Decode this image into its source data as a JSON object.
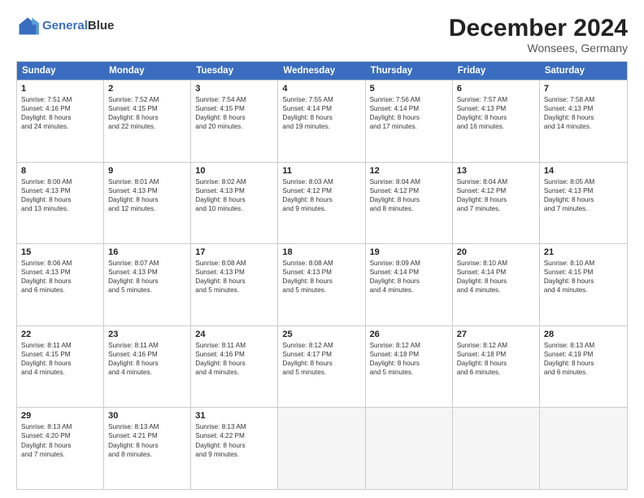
{
  "header": {
    "logo_line1": "General",
    "logo_line2": "Blue",
    "title": "December 2024",
    "subtitle": "Wonsees, Germany"
  },
  "calendar": {
    "weekdays": [
      "Sunday",
      "Monday",
      "Tuesday",
      "Wednesday",
      "Thursday",
      "Friday",
      "Saturday"
    ],
    "rows": [
      [
        {
          "day": "1",
          "lines": [
            "Sunrise: 7:51 AM",
            "Sunset: 4:16 PM",
            "Daylight: 8 hours",
            "and 24 minutes."
          ]
        },
        {
          "day": "2",
          "lines": [
            "Sunrise: 7:52 AM",
            "Sunset: 4:15 PM",
            "Daylight: 8 hours",
            "and 22 minutes."
          ]
        },
        {
          "day": "3",
          "lines": [
            "Sunrise: 7:54 AM",
            "Sunset: 4:15 PM",
            "Daylight: 8 hours",
            "and 20 minutes."
          ]
        },
        {
          "day": "4",
          "lines": [
            "Sunrise: 7:55 AM",
            "Sunset: 4:14 PM",
            "Daylight: 8 hours",
            "and 19 minutes."
          ]
        },
        {
          "day": "5",
          "lines": [
            "Sunrise: 7:56 AM",
            "Sunset: 4:14 PM",
            "Daylight: 8 hours",
            "and 17 minutes."
          ]
        },
        {
          "day": "6",
          "lines": [
            "Sunrise: 7:57 AM",
            "Sunset: 4:13 PM",
            "Daylight: 8 hours",
            "and 16 minutes."
          ]
        },
        {
          "day": "7",
          "lines": [
            "Sunrise: 7:58 AM",
            "Sunset: 4:13 PM",
            "Daylight: 8 hours",
            "and 14 minutes."
          ]
        }
      ],
      [
        {
          "day": "8",
          "lines": [
            "Sunrise: 8:00 AM",
            "Sunset: 4:13 PM",
            "Daylight: 8 hours",
            "and 13 minutes."
          ]
        },
        {
          "day": "9",
          "lines": [
            "Sunrise: 8:01 AM",
            "Sunset: 4:13 PM",
            "Daylight: 8 hours",
            "and 12 minutes."
          ]
        },
        {
          "day": "10",
          "lines": [
            "Sunrise: 8:02 AM",
            "Sunset: 4:13 PM",
            "Daylight: 8 hours",
            "and 10 minutes."
          ]
        },
        {
          "day": "11",
          "lines": [
            "Sunrise: 8:03 AM",
            "Sunset: 4:12 PM",
            "Daylight: 8 hours",
            "and 9 minutes."
          ]
        },
        {
          "day": "12",
          "lines": [
            "Sunrise: 8:04 AM",
            "Sunset: 4:12 PM",
            "Daylight: 8 hours",
            "and 8 minutes."
          ]
        },
        {
          "day": "13",
          "lines": [
            "Sunrise: 8:04 AM",
            "Sunset: 4:12 PM",
            "Daylight: 8 hours",
            "and 7 minutes."
          ]
        },
        {
          "day": "14",
          "lines": [
            "Sunrise: 8:05 AM",
            "Sunset: 4:13 PM",
            "Daylight: 8 hours",
            "and 7 minutes."
          ]
        }
      ],
      [
        {
          "day": "15",
          "lines": [
            "Sunrise: 8:06 AM",
            "Sunset: 4:13 PM",
            "Daylight: 8 hours",
            "and 6 minutes."
          ]
        },
        {
          "day": "16",
          "lines": [
            "Sunrise: 8:07 AM",
            "Sunset: 4:13 PM",
            "Daylight: 8 hours",
            "and 5 minutes."
          ]
        },
        {
          "day": "17",
          "lines": [
            "Sunrise: 8:08 AM",
            "Sunset: 4:13 PM",
            "Daylight: 8 hours",
            "and 5 minutes."
          ]
        },
        {
          "day": "18",
          "lines": [
            "Sunrise: 8:08 AM",
            "Sunset: 4:13 PM",
            "Daylight: 8 hours",
            "and 5 minutes."
          ]
        },
        {
          "day": "19",
          "lines": [
            "Sunrise: 8:09 AM",
            "Sunset: 4:14 PM",
            "Daylight: 8 hours",
            "and 4 minutes."
          ]
        },
        {
          "day": "20",
          "lines": [
            "Sunrise: 8:10 AM",
            "Sunset: 4:14 PM",
            "Daylight: 8 hours",
            "and 4 minutes."
          ]
        },
        {
          "day": "21",
          "lines": [
            "Sunrise: 8:10 AM",
            "Sunset: 4:15 PM",
            "Daylight: 8 hours",
            "and 4 minutes."
          ]
        }
      ],
      [
        {
          "day": "22",
          "lines": [
            "Sunrise: 8:11 AM",
            "Sunset: 4:15 PM",
            "Daylight: 8 hours",
            "and 4 minutes."
          ]
        },
        {
          "day": "23",
          "lines": [
            "Sunrise: 8:11 AM",
            "Sunset: 4:16 PM",
            "Daylight: 8 hours",
            "and 4 minutes."
          ]
        },
        {
          "day": "24",
          "lines": [
            "Sunrise: 8:11 AM",
            "Sunset: 4:16 PM",
            "Daylight: 8 hours",
            "and 4 minutes."
          ]
        },
        {
          "day": "25",
          "lines": [
            "Sunrise: 8:12 AM",
            "Sunset: 4:17 PM",
            "Daylight: 8 hours",
            "and 5 minutes."
          ]
        },
        {
          "day": "26",
          "lines": [
            "Sunrise: 8:12 AM",
            "Sunset: 4:18 PM",
            "Daylight: 8 hours",
            "and 5 minutes."
          ]
        },
        {
          "day": "27",
          "lines": [
            "Sunrise: 8:12 AM",
            "Sunset: 4:18 PM",
            "Daylight: 8 hours",
            "and 6 minutes."
          ]
        },
        {
          "day": "28",
          "lines": [
            "Sunrise: 8:13 AM",
            "Sunset: 4:19 PM",
            "Daylight: 8 hours",
            "and 6 minutes."
          ]
        }
      ],
      [
        {
          "day": "29",
          "lines": [
            "Sunrise: 8:13 AM",
            "Sunset: 4:20 PM",
            "Daylight: 8 hours",
            "and 7 minutes."
          ]
        },
        {
          "day": "30",
          "lines": [
            "Sunrise: 8:13 AM",
            "Sunset: 4:21 PM",
            "Daylight: 8 hours",
            "and 8 minutes."
          ]
        },
        {
          "day": "31",
          "lines": [
            "Sunrise: 8:13 AM",
            "Sunset: 4:22 PM",
            "Daylight: 8 hours",
            "and 9 minutes."
          ]
        },
        null,
        null,
        null,
        null
      ]
    ]
  }
}
